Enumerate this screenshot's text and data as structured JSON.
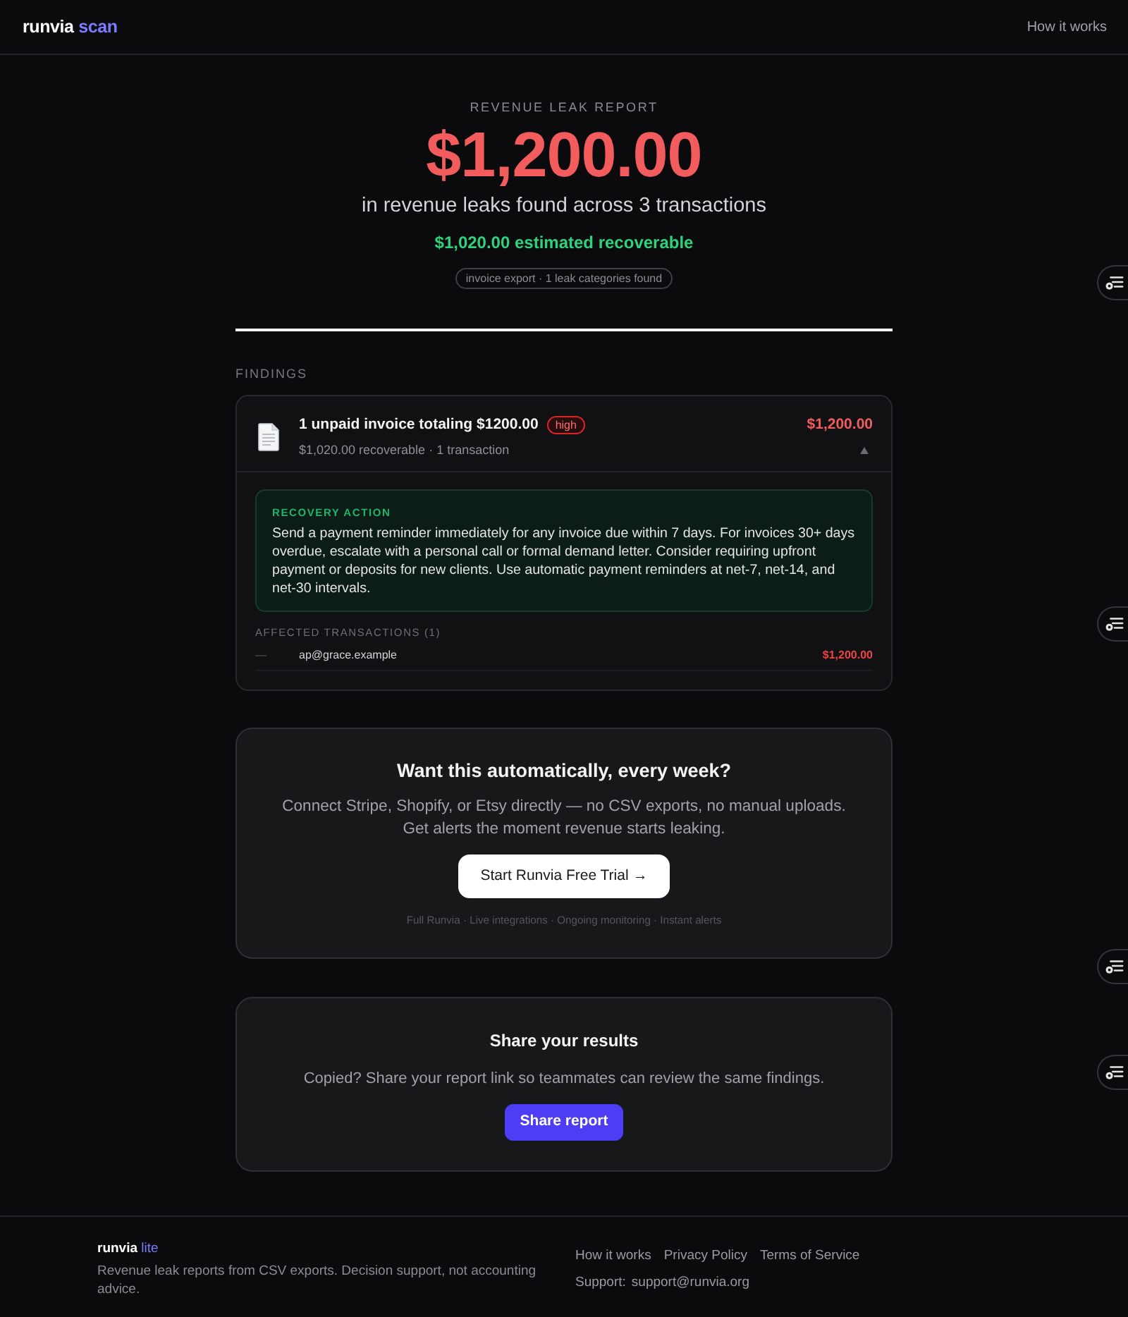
{
  "navbar": {
    "logo": {
      "name": "runvia",
      "suffix": "scan"
    },
    "links": [
      "How it works"
    ]
  },
  "hero": {
    "eyebrow": "REVENUE LEAK REPORT",
    "total": "$1,200.00",
    "subtitle": "in revenue leaks found across 3 transactions",
    "recoverable": "$1,020.00 estimated recoverable",
    "tag": "invoice export · 1 leak categories found"
  },
  "findings": {
    "heading": "FINDINGS",
    "items": [
      {
        "title": "1 unpaid invoice totaling $1200.00",
        "severity": "high",
        "amount": "$1,200.00",
        "meta": "$1,020.00 recoverable · 1 transaction",
        "expanded": true,
        "recovery": {
          "label": "RECOVERY ACTION",
          "text": "Send a payment reminder immediately for any invoice due within 7 days. For invoices 30+ days overdue, escalate with a personal call or formal demand letter. Consider requiring upfront payment or deposits for new clients. Use automatic payment reminders at net-7, net-14, and net-30 intervals."
        },
        "affected": {
          "heading": "AFFECTED TRANSACTIONS (1)",
          "rows": [
            {
              "marker": "—",
              "label": "ap@grace.example",
              "amount": "$1,200.00"
            }
          ]
        }
      }
    ]
  },
  "upsell": {
    "title": "Want this automatically, every week?",
    "text": "Connect Stripe, Shopify, or Etsy directly — no CSV exports, no manual uploads. Get alerts the moment revenue starts leaking.",
    "button": "Start Runvia Free Trial →",
    "features": "Full Runvia · Live integrations · Ongoing monitoring · Instant alerts"
  },
  "share": {
    "title": "Share your results",
    "text": "Copied? Share your report link so teammates can review the same findings.",
    "button": "Share report"
  },
  "footer": {
    "brand": {
      "name": "runvia",
      "suffix": "lite"
    },
    "tagline": "Revenue leak reports from CSV exports. Decision support, not accounting advice.",
    "links": [
      "How it works",
      "Privacy Policy",
      "Terms of Service"
    ],
    "support_label": "Support:",
    "support_email": "support@runvia.org"
  }
}
